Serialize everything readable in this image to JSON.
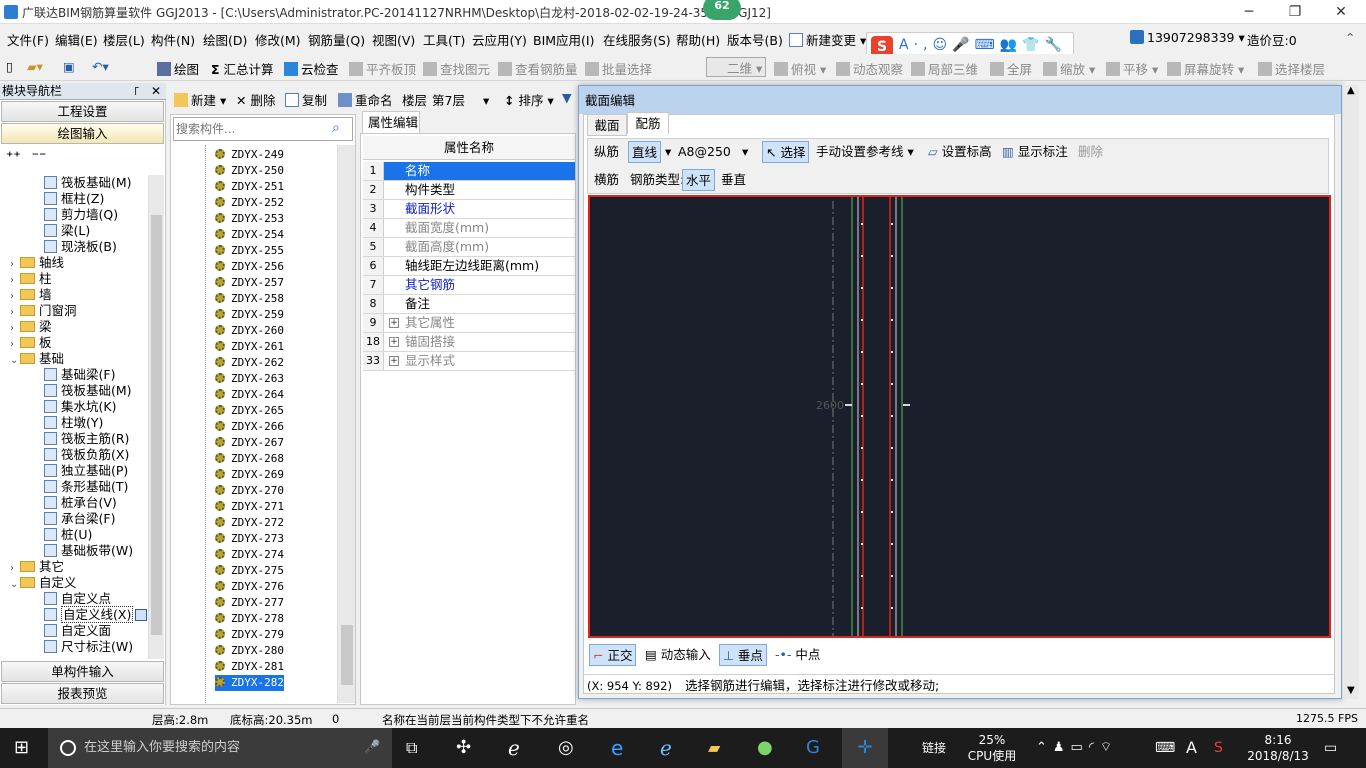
{
  "window": {
    "title": "广联达BIM钢筋算量软件 GGJ2013 - [C:\\Users\\Administrator.PC-20141127NRHM\\Desktop\\白龙村-2018-02-02-19-24-35(1).GGJ12]",
    "badge": "62"
  },
  "menu": [
    "文件(F)",
    "编辑(E)",
    "楼层(L)",
    "构件(N)",
    "绘图(D)",
    "修改(M)",
    "钢筋量(Q)",
    "视图(V)",
    "工具(T)",
    "云应用(Y)",
    "BIM应用(I)",
    "在线服务(S)",
    "帮助(H)",
    "版本号(B)",
    "新建变更"
  ],
  "account": {
    "phone": "13907298339",
    "beans": "造价豆:0"
  },
  "toolbar": {
    "draw": "绘图",
    "sum": "汇总计算",
    "cloud_check": "云检查",
    "flat_top": "平齐板顶",
    "find": "查找图元",
    "view_steel": "查看钢筋量",
    "batch_select": "批量选择",
    "view_mode": "二维",
    "plan_view": "俯视",
    "dynamic_observe": "动态观察",
    "local_3d": "局部三维",
    "full_screen": "全屏",
    "zoom": "缩放",
    "pan": "平移",
    "rotate": "屏幕旋转",
    "select_floor": "选择楼层"
  },
  "nav": {
    "header": "模块导航栏",
    "project_settings": "工程设置",
    "drawing_input": "绘图输入",
    "single_input": "单构件输入",
    "report_preview": "报表预览",
    "tree": [
      {
        "label": "筏板基础(M)",
        "level": 2
      },
      {
        "label": "框柱(Z)",
        "level": 2
      },
      {
        "label": "剪力墙(Q)",
        "level": 2
      },
      {
        "label": "梁(L)",
        "level": 2
      },
      {
        "label": "现浇板(B)",
        "level": 2
      },
      {
        "label": "轴线",
        "level": 1,
        "folder": true,
        "exp": "›"
      },
      {
        "label": "柱",
        "level": 1,
        "folder": true,
        "exp": "›"
      },
      {
        "label": "墙",
        "level": 1,
        "folder": true,
        "exp": "›"
      },
      {
        "label": "门窗洞",
        "level": 1,
        "folder": true,
        "exp": "›"
      },
      {
        "label": "梁",
        "level": 1,
        "folder": true,
        "exp": "›"
      },
      {
        "label": "板",
        "level": 1,
        "folder": true,
        "exp": "›"
      },
      {
        "label": "基础",
        "level": 1,
        "folder": true,
        "exp": "⌄"
      },
      {
        "label": "基础梁(F)",
        "level": 2
      },
      {
        "label": "筏板基础(M)",
        "level": 2
      },
      {
        "label": "集水坑(K)",
        "level": 2
      },
      {
        "label": "柱墩(Y)",
        "level": 2
      },
      {
        "label": "筏板主筋(R)",
        "level": 2
      },
      {
        "label": "筏板负筋(X)",
        "level": 2
      },
      {
        "label": "独立基础(P)",
        "level": 2
      },
      {
        "label": "条形基础(T)",
        "level": 2
      },
      {
        "label": "桩承台(V)",
        "level": 2
      },
      {
        "label": "承台梁(F)",
        "level": 2
      },
      {
        "label": "桩(U)",
        "level": 2
      },
      {
        "label": "基础板带(W)",
        "level": 2
      },
      {
        "label": "其它",
        "level": 1,
        "folder": true,
        "exp": "›"
      },
      {
        "label": "自定义",
        "level": 1,
        "folder": true,
        "exp": "⌄"
      },
      {
        "label": "自定义点",
        "level": 2
      },
      {
        "label": "自定义线(X)",
        "level": 2,
        "selected": true
      },
      {
        "label": "自定义面",
        "level": 2
      },
      {
        "label": "尺寸标注(W)",
        "level": 2
      }
    ]
  },
  "components": {
    "new": "新建",
    "delete": "删除",
    "copy": "复制",
    "rename": "重命名",
    "floor_label": "楼层",
    "floor_value": "第7层",
    "sort": "排序",
    "search_placeholder": "搜索构件...",
    "items": [
      "ZDYX-249",
      "ZDYX-250",
      "ZDYX-251",
      "ZDYX-252",
      "ZDYX-253",
      "ZDYX-254",
      "ZDYX-255",
      "ZDYX-256",
      "ZDYX-257",
      "ZDYX-258",
      "ZDYX-259",
      "ZDYX-260",
      "ZDYX-261",
      "ZDYX-262",
      "ZDYX-263",
      "ZDYX-264",
      "ZDYX-265",
      "ZDYX-266",
      "ZDYX-267",
      "ZDYX-268",
      "ZDYX-269",
      "ZDYX-270",
      "ZDYX-271",
      "ZDYX-272",
      "ZDYX-273",
      "ZDYX-274",
      "ZDYX-275",
      "ZDYX-276",
      "ZDYX-277",
      "ZDYX-278",
      "ZDYX-279",
      "ZDYX-280",
      "ZDYX-281",
      "ZDYX-282"
    ],
    "selected": "ZDYX-282"
  },
  "properties": {
    "tab": "属性编辑",
    "header": "属性名称",
    "rows": [
      {
        "n": "1",
        "v": "名称",
        "style": "sel"
      },
      {
        "n": "2",
        "v": "构件类型",
        "style": ""
      },
      {
        "n": "3",
        "v": "截面形状",
        "style": "blue"
      },
      {
        "n": "4",
        "v": "截面宽度(mm)",
        "style": "gray"
      },
      {
        "n": "5",
        "v": "截面高度(mm)",
        "style": "gray"
      },
      {
        "n": "6",
        "v": "轴线距左边线距离(mm)",
        "style": ""
      },
      {
        "n": "7",
        "v": "其它钢筋",
        "style": "blue"
      },
      {
        "n": "8",
        "v": "备注",
        "style": ""
      },
      {
        "n": "9",
        "v": "其它属性",
        "style": "gray",
        "plus": true
      },
      {
        "n": "18",
        "v": "锚固搭接",
        "style": "gray",
        "plus": true
      },
      {
        "n": "33",
        "v": "显示样式",
        "style": "gray",
        "plus": true
      }
    ]
  },
  "dialog": {
    "title": "截面编辑",
    "tabs": [
      "截面",
      "配筋"
    ],
    "active_tab": "配筋",
    "long_bar": "纵筋",
    "line_mode": "直线",
    "spec": "A8@250",
    "select": "选择",
    "manual_ref": "手动设置参考线",
    "set_mark": "设置标高",
    "show_mark": "显示标注",
    "delete": "删除",
    "transverse": "横筋",
    "bar_type_label": "钢筋类型:",
    "horizontal": "水平",
    "vertical": "垂直",
    "dim_label": "2600",
    "ortho": "正交",
    "dynamic_input": "动态输入",
    "perpendicular": "垂点",
    "midpoint": "中点",
    "coords": "(X: 954 Y: 892)",
    "hint": "选择钢筋进行编辑，选择标注进行修改或移动;"
  },
  "status": {
    "floor_height": "层高:2.8m",
    "bottom_elev": "底标高:20.35m",
    "zero": "0",
    "message": "名称在当前层当前构件类型下不允许重名",
    "fps": "1275.5 FPS"
  },
  "taskbar": {
    "search_placeholder": "在这里输入你要搜索的内容",
    "link": "链接",
    "cpu_pct": "25%",
    "cpu_label": "CPU使用",
    "time": "8:16",
    "date": "2018/8/13",
    "lang": "A"
  },
  "colors": {
    "accent": "#1a73e8",
    "canvas_bg": "#1b1e2b",
    "canvas_border": "#e2231a",
    "rebar_red": "#e2231a",
    "rebar_green": "#58c060"
  }
}
